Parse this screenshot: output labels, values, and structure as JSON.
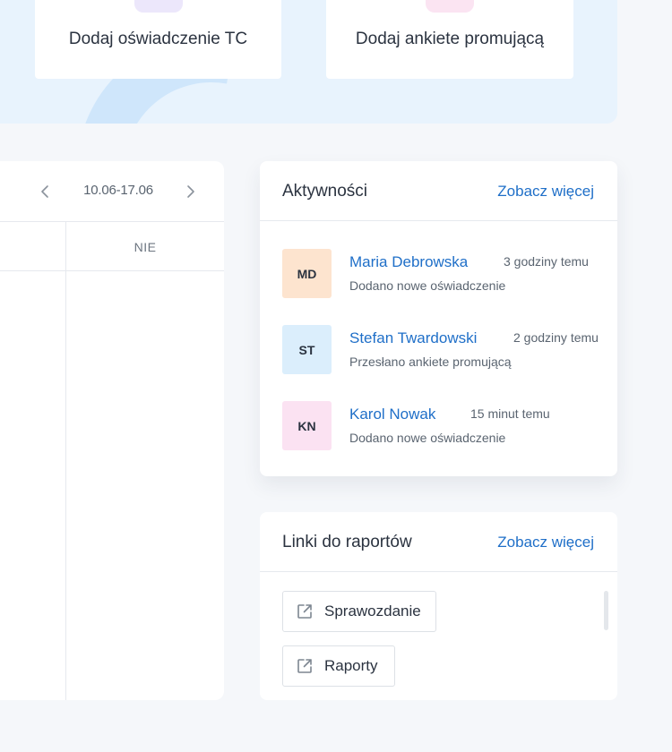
{
  "quick_actions": [
    {
      "label": "Dodaj oświadczenie TC",
      "icon": "document-icon"
    },
    {
      "label": "Dodaj ankiete promującą",
      "icon": "survey-icon"
    }
  ],
  "calendar": {
    "range": "10.06-17.06",
    "visible_day": "NIE"
  },
  "activities": {
    "title": "Aktywności",
    "more_label": "Zobacz więcej",
    "items": [
      {
        "initials": "MD",
        "name": "Maria Debrowska",
        "time": "3 godziny temu",
        "desc": "Dodano nowe oświadczenie",
        "color": "#fde4cf"
      },
      {
        "initials": "ST",
        "name": "Stefan Twardowski",
        "time": "2 godziny temu",
        "desc": "Przesłano ankiete promującą",
        "color": "#dbeefc"
      },
      {
        "initials": "KN",
        "name": "Karol Nowak",
        "time": "15 minut temu",
        "desc": "Dodano nowe oświadczenie",
        "color": "#fbe2f2"
      }
    ]
  },
  "reports": {
    "title": "Linki do raportów",
    "more_label": "Zobacz więcej",
    "links": [
      {
        "label": "Sprawozdanie",
        "icon": "external-link-icon"
      },
      {
        "label": "Raporty",
        "icon": "external-link-icon"
      }
    ]
  },
  "colors": {
    "accent": "#1f6fc8",
    "banner": "#e8f3fd",
    "page_bg": "#f5f7fa"
  }
}
